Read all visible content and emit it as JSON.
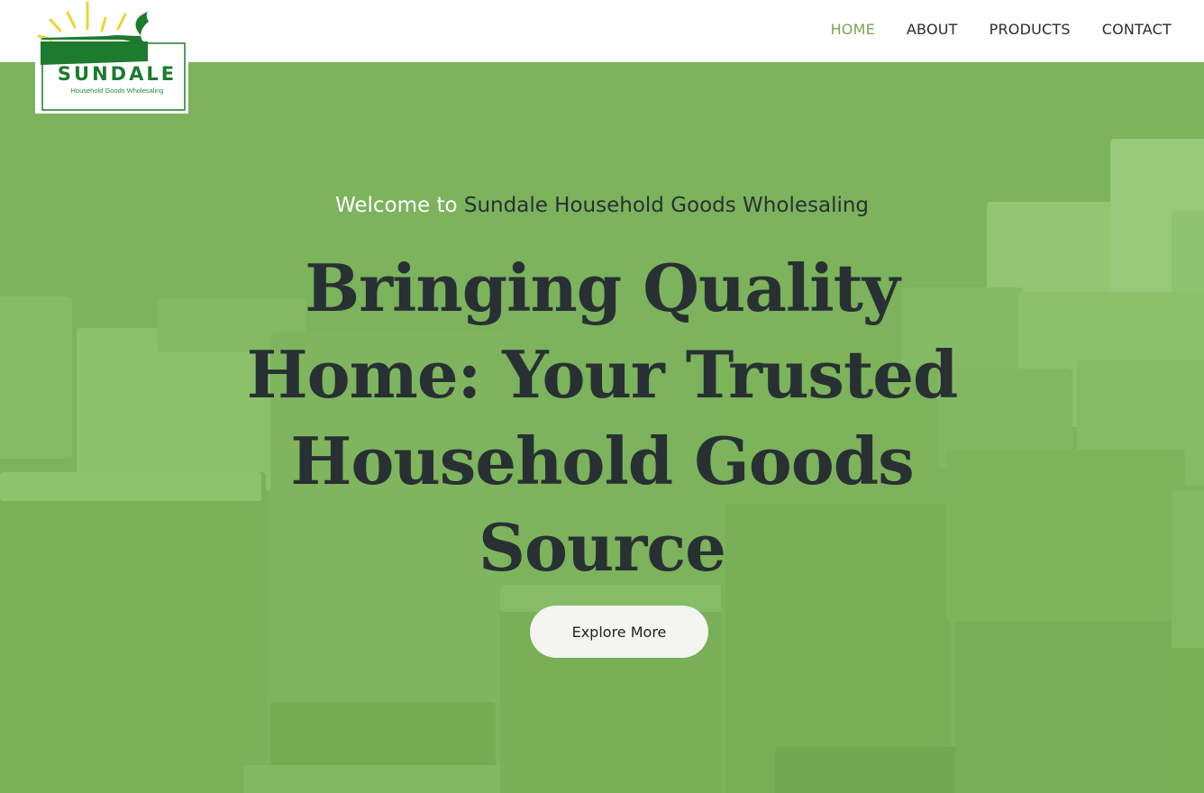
{
  "logo": {
    "name": "SUNDALE",
    "tagline": "Household Goods Wholesaling"
  },
  "nav": {
    "items": [
      {
        "label": "HOME",
        "active": true
      },
      {
        "label": "ABOUT",
        "active": false
      },
      {
        "label": "PRODUCTS",
        "active": false
      },
      {
        "label": "CONTACT",
        "active": false
      }
    ]
  },
  "hero": {
    "welcome_prefix": "Welcome to",
    "welcome_brand": "Sundale Household Goods Wholesaling",
    "headline": "Bringing Quality Home: Your Trusted Household Goods Source",
    "cta_label": "Explore More"
  },
  "colors": {
    "accent": "#7aa84f",
    "hero_green": "#7cb35c",
    "headline_text": "#283033",
    "logo_green": "#1d7a2e",
    "logo_rays": "#f2d230"
  }
}
